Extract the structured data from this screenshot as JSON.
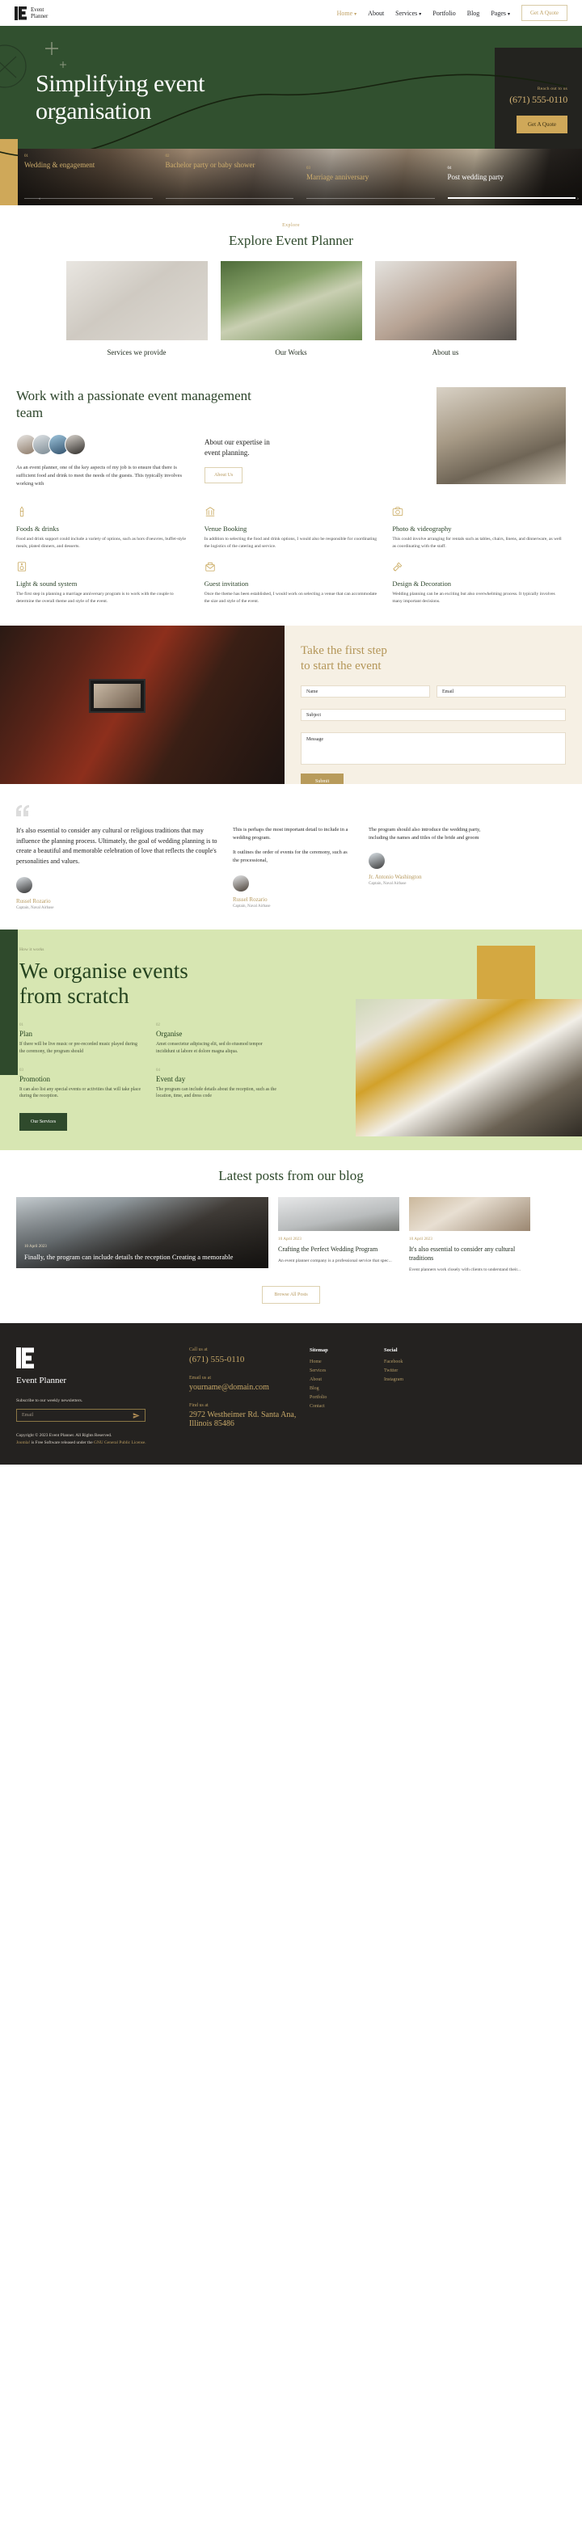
{
  "header": {
    "brand": {
      "line1": "Event",
      "line2": "Planner"
    },
    "nav": [
      {
        "label": "Home",
        "has_caret": true,
        "active": true
      },
      {
        "label": "About",
        "has_caret": false,
        "active": false
      },
      {
        "label": "Services",
        "has_caret": true,
        "active": false
      },
      {
        "label": "Portfolio",
        "has_caret": false,
        "active": false
      },
      {
        "label": "Blog",
        "has_caret": false,
        "active": false
      },
      {
        "label": "Pages",
        "has_caret": true,
        "active": false
      }
    ],
    "quote_button": "Get A Quote"
  },
  "hero": {
    "title_line1": "Simplifying event",
    "title_line2": "organisation",
    "reach_label": "Reach out to us",
    "phone": "(671) 555-0110",
    "cta": "Get A Quote",
    "categories": [
      {
        "num": "01",
        "label": "Wedding & engagement",
        "active": false
      },
      {
        "num": "02",
        "label": "Bachelor party or baby shower",
        "active": false
      },
      {
        "num": "03",
        "label": "Marriage anniversary",
        "active": false
      },
      {
        "num": "04",
        "label": "Post wedding party",
        "active": true
      }
    ],
    "prev_arrow": "‹",
    "next_arrow": "›"
  },
  "explore": {
    "eyebrow": "Explore",
    "title": "Explore Event Planner",
    "cards": [
      {
        "caption": "Services we provide"
      },
      {
        "caption": "Our Works"
      },
      {
        "caption": "About us"
      }
    ]
  },
  "passionate": {
    "title": "Work with a passionate event management team",
    "body": "As an event planner, one of the key aspects of my job is to ensure that there is sufficient food and drink to meet the needs of the guests. This typically involves working with",
    "sub_heading": "About our expertise in event planning.",
    "button": "About Us"
  },
  "services": [
    {
      "icon": "drink-icon",
      "title": "Foods & drinks",
      "text": "Food and drink support could include a variety of options, such as hors d'oeuvres, buffet-style meals, plated dinners, and desserts."
    },
    {
      "icon": "venue-icon",
      "title": "Venue Booking",
      "text": "In addition to selecting the food and drink options, I would also be responsible for coordinating the logistics of the catering and service."
    },
    {
      "icon": "camera-icon",
      "title": "Photo & videography",
      "text": "This could involve arranging for rentals such as tables, chairs, linens, and dinnerware, as well as coordinating with the staff."
    },
    {
      "icon": "light-sound-icon",
      "title": "Light & sound system",
      "text": "The first step in planning a marriage anniversary program is to work with the couple to determine the overall theme and style of the event."
    },
    {
      "icon": "invitation-icon",
      "title": "Guest invitation",
      "text": "Once the theme has been established, I would work on selecting a venue that can accommodate the size and style of the event."
    },
    {
      "icon": "decoration-icon",
      "title": "Design & Decoration",
      "text": "Wedding planning can be an exciting but also overwhelming process. It typically involves many important decisions."
    }
  ],
  "contact": {
    "title_line1": "Take the first step",
    "title_line2": "to start the event",
    "name_placeholder": "Name",
    "email_placeholder": "Email",
    "subject_placeholder": "Subject",
    "message_placeholder": "Message",
    "submit": "Submit"
  },
  "testimonials": [
    {
      "quote": "It's also essential to consider any cultural or religious traditions that may influence the planning process. Ultimately, the goal of wedding planning is to create a beautiful and memorable celebration of love that reflects the couple's personalities and values.",
      "name": "Russel Rozario",
      "role": "Captain, Naval Airbase"
    },
    {
      "quote": "This is perhaps the most important detail to include in a wedding program.",
      "quote2": "It outlines the order of events for the ceremony, such as the processional,",
      "name": "Russel Rozario",
      "role": "Captain, Naval Airbase"
    },
    {
      "quote": "The program should also introduce the wedding party, including the names and titles of the bride and groom",
      "name": "Jr. Antonio Washington",
      "role": "Captain, Naval Airbase"
    }
  ],
  "organise": {
    "eyebrow": "How it works",
    "title_line1": "We organise events",
    "title_line2": "from scratch",
    "steps": [
      {
        "num": "01",
        "title": "Plan",
        "text": "If there will be live music or pre-recorded music played during the ceremony, the program should"
      },
      {
        "num": "02",
        "title": "Organise",
        "text": "Amet consectetur adipiscing elit, sed do eiusmod tempor incididunt ut labore et dolore magna aliqua."
      },
      {
        "num": "03",
        "title": "Promotion",
        "text": "It can also list any special events or activities that will take place during the reception."
      },
      {
        "num": "04",
        "title": "Event day",
        "text": "The program can include details about the reception, such as the location, time, and dress code"
      }
    ],
    "button": "Our Services"
  },
  "blog": {
    "title": "Latest posts from our blog",
    "featured": {
      "date": "10 April 2023",
      "headline": "Finally, the program can include details the reception Creating a memorable"
    },
    "posts": [
      {
        "date": "10 April 2023",
        "headline": "Crafting the Perfect Wedding Program",
        "excerpt": "An event planner company is a professional service that spec..."
      },
      {
        "date": "10 April 2023",
        "headline": "It's also essential to consider any cultural traditions",
        "excerpt": "Event planners work closely with clients to understand their..."
      }
    ],
    "browse_button": "Browse All Posts"
  },
  "footer": {
    "brand": "Event Planner",
    "subscribe_label": "Subscribe to our weekly newsletters.",
    "email_placeholder": "Email",
    "copyright_1": "Copyright © 2023 Event Planner. All Rights Reserved.",
    "copyright_joomla": "Joomla!",
    "copyright_2": " is Free Software released under the ",
    "copyright_license": "GNU General Public License.",
    "call_label": "Call us at",
    "call_value": "(671) 555-0110",
    "email_label": "Email us at",
    "email_value": "yourname@domain.com",
    "find_label": "Find us at",
    "find_value": "2972 Westheimer Rd. Santa Ana, Illinois 85486",
    "sitemap_heading": "Sitemap",
    "sitemap": [
      "Home",
      "Services",
      "About",
      "Blog",
      "Portfolio",
      "Contact"
    ],
    "social_heading": "Social",
    "social": [
      "Facebook",
      "Twitter",
      "Instagram"
    ]
  }
}
